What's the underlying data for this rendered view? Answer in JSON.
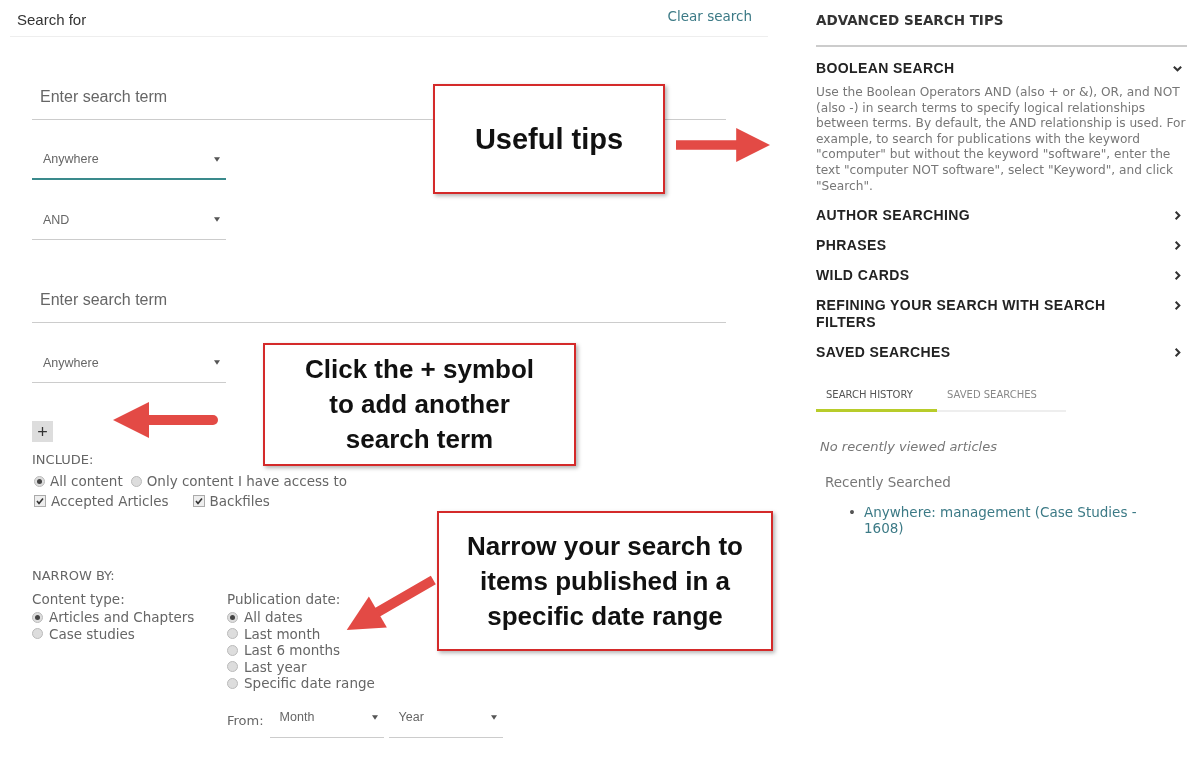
{
  "search_form": {
    "header_label": "Search for",
    "clear_link": "Clear search",
    "rows": [
      {
        "kind": "term",
        "placeholder": "Enter search term"
      },
      {
        "kind": "select",
        "value": "Anywhere",
        "focused": true
      },
      {
        "kind": "select",
        "value": "AND",
        "focused": false
      },
      {
        "kind": "term",
        "placeholder": "Enter search term"
      },
      {
        "kind": "select",
        "value": "Anywhere",
        "focused": false
      }
    ],
    "add_button": "+",
    "include": {
      "label": "INCLUDE:",
      "radios": [
        {
          "label": "All content",
          "selected": true
        },
        {
          "label": "Only content I have access to",
          "selected": false
        }
      ],
      "checkboxes": [
        {
          "label": "Accepted Articles",
          "checked": true
        },
        {
          "label": "Backfiles",
          "checked": true
        }
      ]
    },
    "narrow_by": {
      "label": "NARROW BY:",
      "groups": [
        {
          "label": "Content type:",
          "options": [
            {
              "label": "Articles and Chapters",
              "selected": true
            },
            {
              "label": "Case studies",
              "selected": false
            }
          ]
        },
        {
          "label": "Publication date:",
          "options": [
            {
              "label": "All dates",
              "selected": true
            },
            {
              "label": "Last month",
              "selected": false
            },
            {
              "label": "Last 6 months",
              "selected": false
            },
            {
              "label": "Last year",
              "selected": false
            },
            {
              "label": "Specific date range",
              "selected": false
            }
          ]
        }
      ],
      "from": {
        "label": "From:",
        "selects": [
          "Month",
          "Year"
        ]
      }
    }
  },
  "tips": {
    "title": "ADVANCED SEARCH TIPS",
    "sections": [
      {
        "title": "BOOLEAN SEARCH",
        "expanded": true,
        "body": "Use the Boolean Operators AND (also + or &), OR, and NOT (also -) in search terms to specify logical relationships between terms. By default, the AND relationship is used. For example, to search for publications with the keyword \"computer\" but without the keyword \"software\", enter the text \"computer NOT software\", select \"Keyword\", and click \"Search\"."
      },
      {
        "title": "AUTHOR SEARCHING",
        "expanded": false
      },
      {
        "title": "PHRASES",
        "expanded": false
      },
      {
        "title": "WILD CARDS",
        "expanded": false
      },
      {
        "title": "REFINING YOUR SEARCH WITH SEARCH FILTERS",
        "expanded": false
      },
      {
        "title": "SAVED SEARCHES",
        "expanded": false
      }
    ]
  },
  "history_tabs": [
    {
      "label": "SEARCH HISTORY",
      "selected": true
    },
    {
      "label": "SAVED SEARCHES",
      "selected": false
    }
  ],
  "history": {
    "empty_note": "No recently viewed articles",
    "recent_label": "Recently Searched",
    "items": [
      {
        "marker": "•",
        "text": "Anywhere: management (Case Studies - 1608)"
      }
    ]
  },
  "callouts": [
    {
      "text": "Useful tips"
    },
    {
      "text": "Click the + symbol to add another search term"
    },
    {
      "text": "Narrow your search to items published in a specific date range"
    }
  ]
}
